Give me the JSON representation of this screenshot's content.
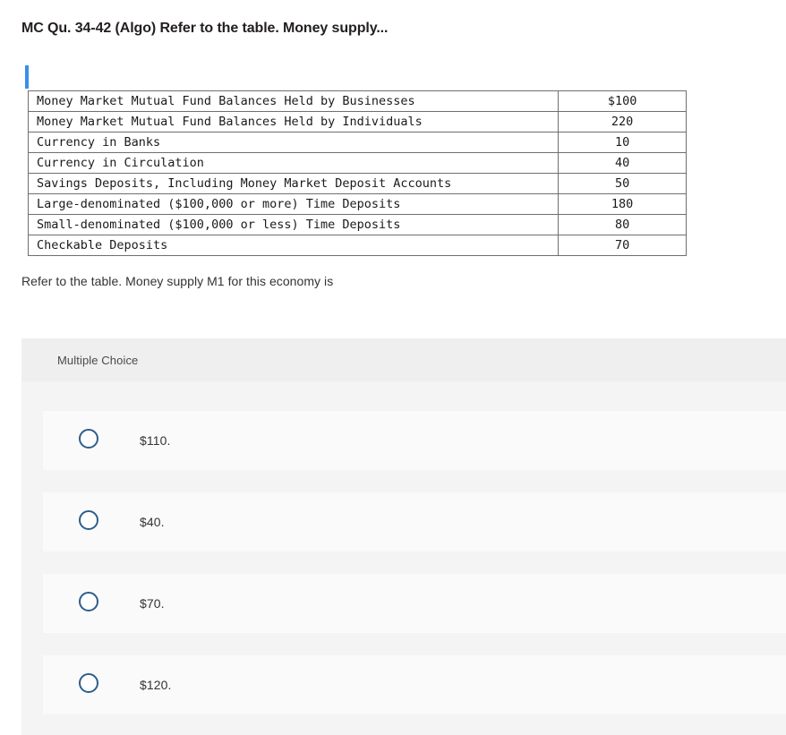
{
  "question": {
    "title": "MC Qu. 34-42 (Algo) Refer to the table. Money supply...",
    "prompt": "Refer to the table. Money supply M1 for this economy is"
  },
  "table": {
    "rows": [
      {
        "label": "Money Market Mutual Fund Balances Held by Businesses",
        "value": "$100"
      },
      {
        "label": "Money Market Mutual Fund Balances Held by Individuals",
        "value": "220"
      },
      {
        "label": "Currency in Banks",
        "value": "10"
      },
      {
        "label": "Currency in Circulation",
        "value": "40"
      },
      {
        "label": "Savings Deposits, Including Money Market Deposit Accounts",
        "value": "50"
      },
      {
        "label": "Large-denominated ($100,000 or more) Time Deposits",
        "value": "180"
      },
      {
        "label": "Small-denominated ($100,000 or less) Time Deposits",
        "value": "80"
      },
      {
        "label": "Checkable Deposits",
        "value": "70"
      }
    ]
  },
  "answer_panel": {
    "header_label": "Multiple Choice",
    "options": [
      {
        "label": "$110.",
        "selected": false
      },
      {
        "label": "$40.",
        "selected": false
      },
      {
        "label": "$70.",
        "selected": false
      },
      {
        "label": "$120.",
        "selected": false
      }
    ]
  },
  "colors": {
    "caret": "#3b8ee8",
    "radio_border": "#2d5f8b",
    "panel_background": "#f4f4f4",
    "panel_header_background": "#efefef",
    "option_row_background": "#fafafa",
    "table_border": "#6f6f6f",
    "text": "#231f20"
  }
}
